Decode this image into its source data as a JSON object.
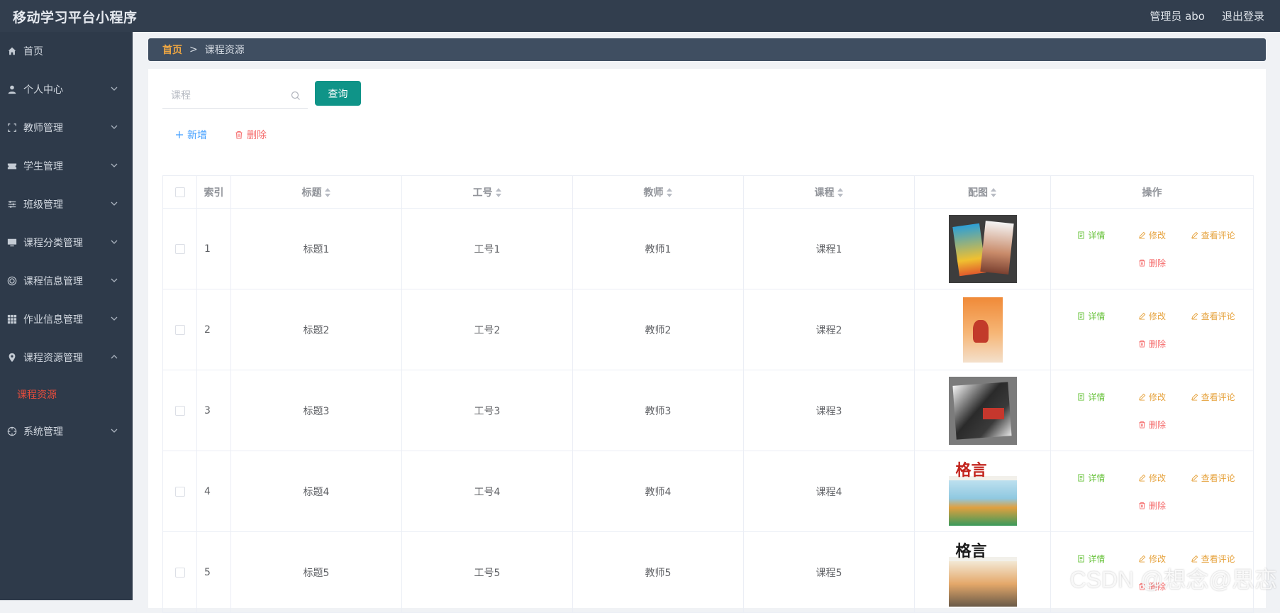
{
  "app": {
    "title": "移动学习平台小程序",
    "user": "管理员 abo",
    "logout": "退出登录"
  },
  "sidebar": {
    "items": [
      {
        "label": "首页",
        "icon": "home-icon"
      },
      {
        "label": "个人中心",
        "icon": "user-icon"
      },
      {
        "label": "教师管理",
        "icon": "frame-icon"
      },
      {
        "label": "学生管理",
        "icon": "ticket-icon"
      },
      {
        "label": "班级管理",
        "icon": "sliders-icon"
      },
      {
        "label": "课程分类管理",
        "icon": "monitor-icon"
      },
      {
        "label": "课程信息管理",
        "icon": "target-icon"
      },
      {
        "label": "作业信息管理",
        "icon": "grid-icon"
      },
      {
        "label": "课程资源管理",
        "icon": "location-icon"
      },
      {
        "label": "课程资源",
        "icon": ""
      },
      {
        "label": "系统管理",
        "icon": "crosshair-icon"
      }
    ]
  },
  "breadcrumb": {
    "home": "首页",
    "sep": ">",
    "current": "课程资源"
  },
  "search": {
    "placeholder": "课程",
    "value": "",
    "button": "查询"
  },
  "actions": {
    "add": "新增",
    "delete": "删除"
  },
  "table": {
    "headers": [
      "索引",
      "标题",
      "工号",
      "教师",
      "课程",
      "配图",
      "操作"
    ],
    "rows": [
      {
        "index": "1",
        "title": "标题1",
        "number": "工号1",
        "teacher": "教师1",
        "course": "课程1"
      },
      {
        "index": "2",
        "title": "标题2",
        "number": "工号2",
        "teacher": "教师2",
        "course": "课程2"
      },
      {
        "index": "3",
        "title": "标题3",
        "number": "工号3",
        "teacher": "教师3",
        "course": "课程3"
      },
      {
        "index": "4",
        "title": "标题4",
        "number": "工号4",
        "teacher": "教师4",
        "course": "课程4"
      },
      {
        "index": "5",
        "title": "标题5",
        "number": "工号5",
        "teacher": "教师5",
        "course": "课程5"
      }
    ],
    "ops": {
      "detail": "详情",
      "edit": "修改",
      "review": "查看评论",
      "delete": "删除"
    }
  },
  "watermark": "CSDN @想念@思恋",
  "colors": {
    "topbar": "#323e4e",
    "sidebar": "#2e3a4a",
    "breadcrumb": "#3f4e61",
    "accent": "#0f9488",
    "active_menu": "#e74c3c"
  }
}
